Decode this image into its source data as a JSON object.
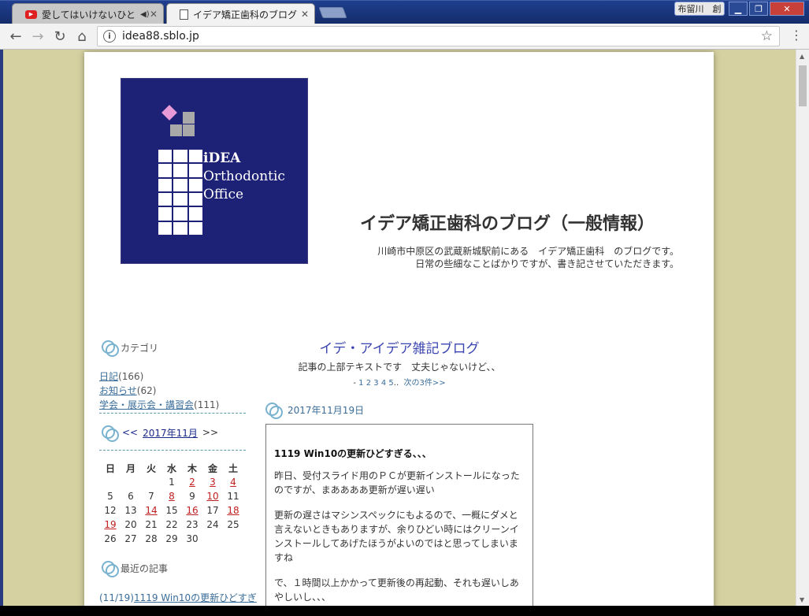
{
  "browser": {
    "tabs": [
      {
        "title": "愛してはいけないひと",
        "active": false,
        "icon": "youtube-icon"
      },
      {
        "title": "イデア矯正歯科のブログ",
        "active": true,
        "icon": "page-icon"
      }
    ],
    "user_name": "布留川　創",
    "url": "idea88.sblo.jp"
  },
  "header": {
    "logo_lines": [
      "iDEA",
      "Orthodontic",
      "Office"
    ],
    "blog_title": "イデア矯正歯科のブログ（一般情報）",
    "description_1": "川崎市中原区の武蔵新城駅前にある　イデア矯正歯科　のブログです。",
    "description_2": "日常の些細なことばかりですが、書き記させていただきます。"
  },
  "sidebar": {
    "category_heading": "カテゴリ",
    "categories": [
      {
        "label": "日記",
        "count": "(166)"
      },
      {
        "label": "お知らせ",
        "count": "(62)"
      },
      {
        "label": "学会・展示会・講習会",
        "count": "(111)"
      }
    ],
    "cal_prev": "<<",
    "cal_month": "2017年11月",
    "cal_next": ">>",
    "weekdays": [
      "日",
      "月",
      "火",
      "水",
      "木",
      "金",
      "土"
    ],
    "weeks": [
      [
        {
          "d": ""
        },
        {
          "d": ""
        },
        {
          "d": ""
        },
        {
          "d": "1"
        },
        {
          "d": "2",
          "link": true
        },
        {
          "d": "3",
          "link": true
        },
        {
          "d": "4",
          "link": true
        }
      ],
      [
        {
          "d": "5"
        },
        {
          "d": "6"
        },
        {
          "d": "7"
        },
        {
          "d": "8",
          "link": true
        },
        {
          "d": "9"
        },
        {
          "d": "10",
          "link": true
        },
        {
          "d": "11"
        }
      ],
      [
        {
          "d": "12"
        },
        {
          "d": "13"
        },
        {
          "d": "14",
          "link": true
        },
        {
          "d": "15"
        },
        {
          "d": "16",
          "link": true
        },
        {
          "d": "17"
        },
        {
          "d": "18",
          "link": true
        }
      ],
      [
        {
          "d": "19",
          "link": true
        },
        {
          "d": "20"
        },
        {
          "d": "21"
        },
        {
          "d": "22"
        },
        {
          "d": "23"
        },
        {
          "d": "24"
        },
        {
          "d": "25"
        }
      ],
      [
        {
          "d": "26"
        },
        {
          "d": "27"
        },
        {
          "d": "28"
        },
        {
          "d": "29"
        },
        {
          "d": "30"
        },
        {
          "d": ""
        },
        {
          "d": ""
        }
      ]
    ],
    "recent_heading": "最近の記事",
    "recent_date": "(11/19)",
    "recent_title": "1119 Win10の更新ひどすぎ"
  },
  "main": {
    "section_title": "イデ・アイデア雑記ブログ",
    "section_sub": "記事の上部テキストです　丈夫じゃないけど、、",
    "pager_prefix": "- ",
    "pages": [
      "1",
      "2",
      "3",
      "4",
      "5"
    ],
    "pager_sep": "..",
    "next_link": "次の3件>>",
    "date": "2017年11月19日",
    "entry_title": "1119 Win10の更新ひどすぎる、、、",
    "paragraphs": [
      "昨日、受付スライド用のＰＣが更新インストールになったのですが、まああああ更新が遅い遅い",
      "更新の遅さはマシンスペックにもよるので、一概にダメと言えないときもありますが、余りひどい時にはクリーンインストールしてあげたほうがよいのではと思ってしまいますね",
      "で、１時間以上かかって更新後の再起動、それも遅いしあやしいし、、、"
    ]
  }
}
